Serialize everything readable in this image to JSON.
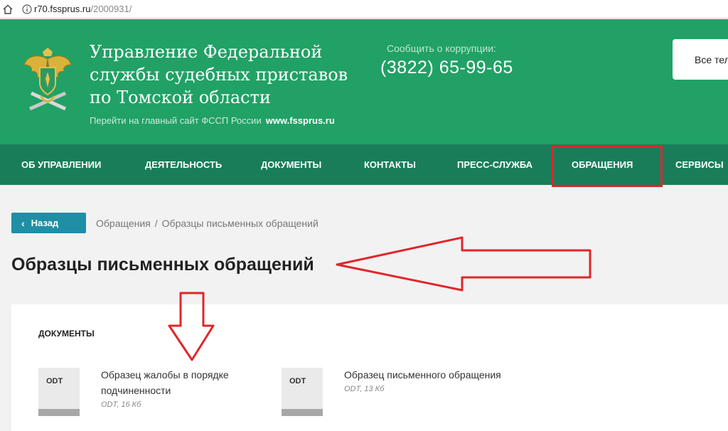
{
  "browser": {
    "url_host": "r70.fssprus.ru",
    "url_path": "/2000931/",
    "icons": [
      "home-icon",
      "info-icon"
    ]
  },
  "header": {
    "title_lines": [
      "Управление Федеральной",
      "службы судебных приставов",
      "по Томской области"
    ],
    "main_link_text": "Перейти на главный сайт ФССП России",
    "main_link_url_text": "www.fssprus.ru",
    "corruption_label": "Сообщить о коррупции:",
    "phone": "(3822) 65-99-65",
    "phones_button": "Все телефоны",
    "colors": {
      "header_bg": "#21a166",
      "nav_bg": "#1a7d5a"
    }
  },
  "nav": {
    "items": [
      {
        "label": "ОБ УПРАВЛЕНИИ"
      },
      {
        "label": "ДЕЯТЕЛЬНОСТЬ"
      },
      {
        "label": "ДОКУМЕНТЫ"
      },
      {
        "label": "КОНТАКТЫ"
      },
      {
        "label": "ПРЕСС-СЛУЖБА"
      },
      {
        "label": "ОБРАЩЕНИЯ"
      },
      {
        "label": "СЕРВИСЫ"
      }
    ],
    "highlighted": "ОБРАЩЕНИЯ",
    "highlight_color": "#e0262a"
  },
  "breadcrumb": {
    "back_label": "Назад",
    "items": [
      "Обращения",
      "Образцы письменных обращений"
    ],
    "separator": "/"
  },
  "page": {
    "title": "Образцы письменных обращений"
  },
  "documents": {
    "heading": "ДОКУМЕНТЫ",
    "items": [
      {
        "badge": "ODT",
        "title_lines": [
          "Образец жалобы в порядке",
          "подчиненности"
        ],
        "meta": "ODT, 16 Кб"
      },
      {
        "badge": "ODT",
        "title_lines": [
          "Образец письменного обращения"
        ],
        "meta": "ODT, 13 Кб"
      }
    ]
  },
  "annotations": {
    "arrow_color": "#e0262a"
  }
}
